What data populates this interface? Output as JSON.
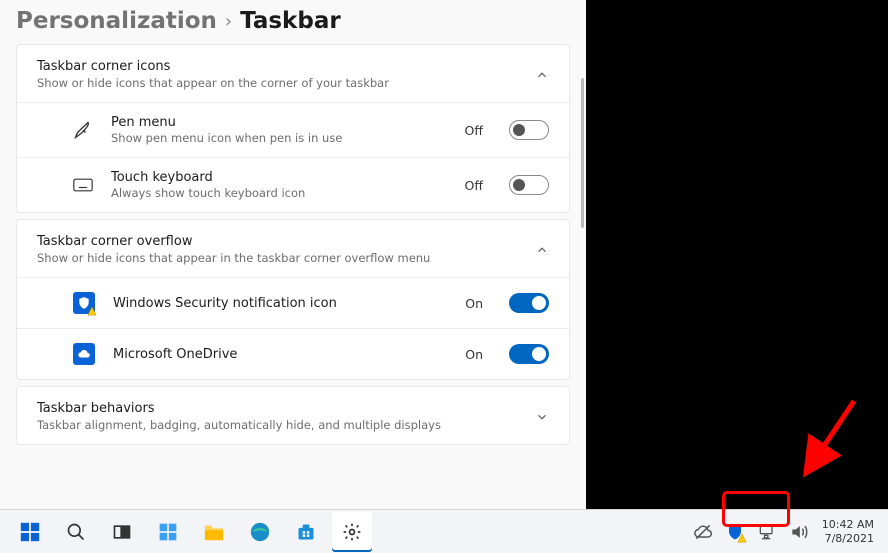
{
  "breadcrumb": {
    "parent": "Personalization",
    "current": "Taskbar"
  },
  "sections": {
    "cornerIcons": {
      "title": "Taskbar corner icons",
      "sub": "Show or hide icons that appear on the corner of your taskbar",
      "items": [
        {
          "title": "Pen menu",
          "sub": "Show pen menu icon when pen is in use",
          "state": "Off",
          "on": false,
          "icon": "pen"
        },
        {
          "title": "Touch keyboard",
          "sub": "Always show touch keyboard icon",
          "state": "Off",
          "on": false,
          "icon": "keyboard"
        }
      ]
    },
    "overflow": {
      "title": "Taskbar corner overflow",
      "sub": "Show or hide icons that appear in the taskbar corner overflow menu",
      "items": [
        {
          "title": "Windows Security notification icon",
          "state": "On",
          "on": true,
          "icon": "shield"
        },
        {
          "title": "Microsoft OneDrive",
          "state": "On",
          "on": true,
          "icon": "cloud"
        }
      ]
    },
    "behaviors": {
      "title": "Taskbar behaviors",
      "sub": "Taskbar alignment, badging, automatically hide, and multiple displays"
    }
  },
  "taskbar": {
    "apps": [
      "start",
      "search",
      "taskview",
      "widgets",
      "explorer",
      "edge",
      "store",
      "settings"
    ],
    "tray": [
      "cloud-off",
      "shield-warn",
      "computer",
      "volume"
    ],
    "clock": {
      "time": "10:42 AM",
      "date": "7/8/2021"
    }
  },
  "colors": {
    "accent": "#0067c0"
  }
}
